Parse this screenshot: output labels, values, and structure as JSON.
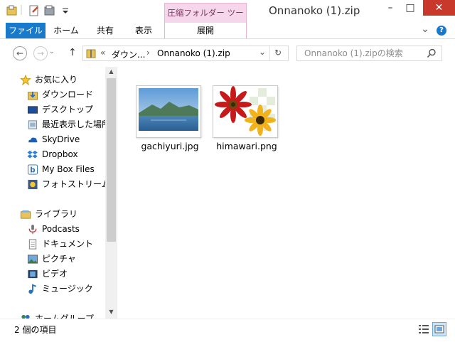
{
  "window": {
    "title": "Onnanoko (1).zip",
    "context_tab": "圧縮フォルダー ツール",
    "minimize": "–",
    "maximize": "□",
    "close": "✕"
  },
  "ribbon": {
    "tabs": [
      {
        "label": "ファイル"
      },
      {
        "label": "ホーム"
      },
      {
        "label": "共有"
      },
      {
        "label": "表示"
      },
      {
        "label": "展開"
      }
    ],
    "expand_chevron": "⌄",
    "help": "?"
  },
  "nav_buttons": {
    "back": "←",
    "forward": "→",
    "up": "↑"
  },
  "address": {
    "prefix": "«",
    "crumb1": "ダウン...",
    "sep": "›",
    "crumb2": "Onnanoko (1).zip",
    "dropdown": "⌄",
    "refresh": "↻"
  },
  "search": {
    "placeholder": "Onnanoko (1).zipの検索",
    "icon": "search-icon"
  },
  "sidebar": {
    "items": [
      {
        "label": "お気に入り",
        "icon": "star-icon",
        "root": true
      },
      {
        "label": "ダウンロード",
        "icon": "download-folder-icon"
      },
      {
        "label": "デスクトップ",
        "icon": "desktop-icon"
      },
      {
        "label": "最近表示した場所",
        "icon": "recent-places-icon"
      },
      {
        "label": "SkyDrive",
        "icon": "skydrive-icon"
      },
      {
        "label": "Dropbox",
        "icon": "dropbox-icon"
      },
      {
        "label": "My Box Files",
        "icon": "box-icon"
      },
      {
        "label": "フォトストリーム",
        "icon": "photostream-icon"
      },
      {
        "label": "ライブラリ",
        "icon": "library-icon",
        "root": true
      },
      {
        "label": "Podcasts",
        "icon": "podcast-icon"
      },
      {
        "label": "ドキュメント",
        "icon": "document-icon"
      },
      {
        "label": "ピクチャ",
        "icon": "pictures-icon"
      },
      {
        "label": "ビデオ",
        "icon": "video-icon"
      },
      {
        "label": "ミュージック",
        "icon": "music-icon"
      },
      {
        "label": "ホームグループ",
        "icon": "homegroup-icon",
        "root": true
      }
    ]
  },
  "files": [
    {
      "name": "gachiyuri.jpg",
      "icon": "landscape-thumbnail"
    },
    {
      "name": "himawari.png",
      "icon": "flower-thumbnail"
    }
  ],
  "status": {
    "count_text": "2 個の項目"
  },
  "colors": {
    "file_tab": "#1979ca",
    "context_tab": "#f6d6ea",
    "close_button": "#c8392b"
  }
}
